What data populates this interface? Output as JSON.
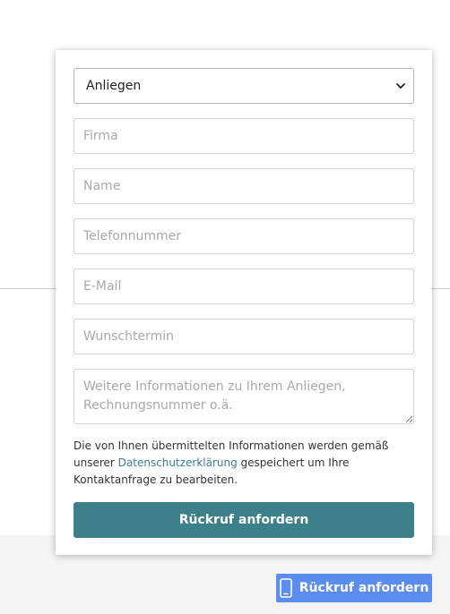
{
  "form": {
    "concern_select": {
      "selected": "Anliegen"
    },
    "company_placeholder": "Firma",
    "name_placeholder": "Name",
    "phone_placeholder": "Telefonnummer",
    "email_placeholder": "E-Mail",
    "appointment_placeholder": "Wunschtermin",
    "info_placeholder": "Weitere Informationen zu Ihrem Anliegen, Rechnungsnummer o.ä.",
    "privacy": {
      "text_before": "Die von Ihnen übermittelten Informationen werden gemäß unserer ",
      "link_label": "Datenschutzerklärung",
      "text_after": " gespeichert um Ihre Kontaktanfrage zu bearbeiten."
    },
    "submit_label": "Rückruf anfordern"
  },
  "floating_button": {
    "label": "Rückruf anfordern",
    "icon": "mobile-phone-icon"
  },
  "colors": {
    "submit_bg": "#3c8189",
    "link": "#3a7f8a",
    "floating_bg": "#5b8df0"
  }
}
